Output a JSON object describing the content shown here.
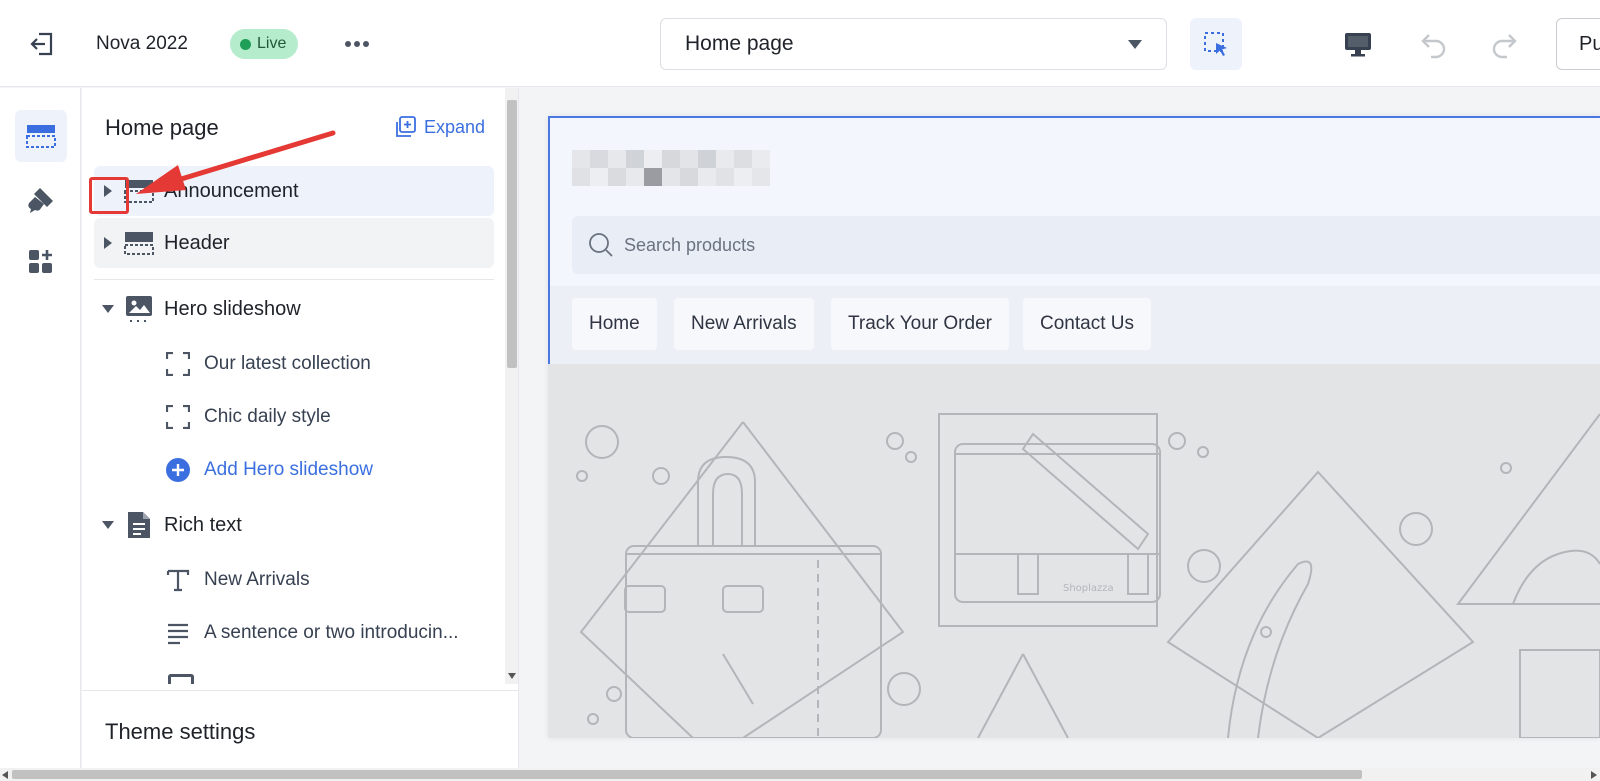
{
  "topbar": {
    "store_name": "Nova 2022",
    "live_label": "Live",
    "page_selector": "Home page",
    "publish_label": "Pu"
  },
  "panel": {
    "title": "Home page",
    "expand_label": "Expand",
    "sections": [
      {
        "label": "Announcement"
      },
      {
        "label": "Header"
      },
      {
        "label": "Hero slideshow"
      },
      {
        "label": "Rich text"
      }
    ],
    "hero_blocks": [
      {
        "label": "Our latest collection"
      },
      {
        "label": "Chic daily style"
      }
    ],
    "add_hero_label": "Add Hero slideshow",
    "rich_blocks": [
      {
        "label": "New Arrivals"
      },
      {
        "label": "A sentence or two introducin..."
      }
    ],
    "theme_settings": "Theme settings"
  },
  "preview": {
    "search_placeholder": "Search products",
    "nav": [
      "Home",
      "New Arrivals",
      "Track Your Order",
      "Contact Us"
    ],
    "watermark": "Shoplazza"
  },
  "colors": {
    "accent": "#3b6fe0",
    "live_bg": "#b5eccb",
    "annotation": "#e53935"
  }
}
